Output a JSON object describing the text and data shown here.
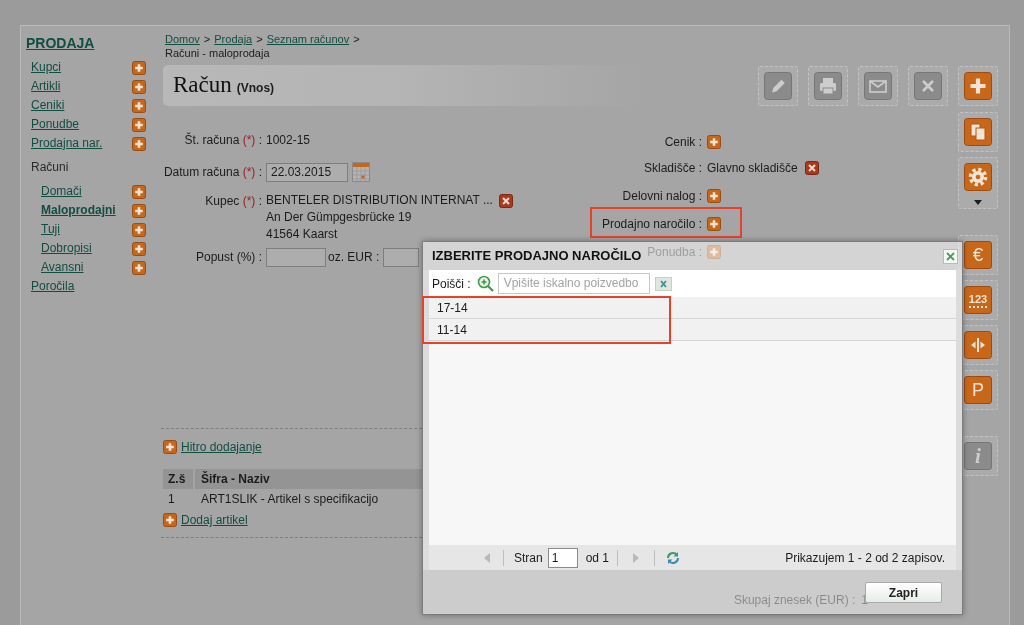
{
  "breadcrumb": [
    {
      "kind": "link",
      "label": "Domov",
      "separator": ">"
    },
    {
      "kind": "link",
      "label": "Prodaja",
      "separator": ">"
    },
    {
      "kind": "link",
      "label": "Seznam računov",
      "separator": ">"
    },
    {
      "kind": "current",
      "label": "Računi - maloprodaja"
    }
  ],
  "sidebar": {
    "title": "PRODAJA",
    "items": [
      {
        "kind": "link",
        "label": "Kupci",
        "selected": false,
        "add": true
      },
      {
        "kind": "link",
        "label": "Artikli",
        "selected": false,
        "add": true
      },
      {
        "kind": "link",
        "label": "Ceniki",
        "selected": false,
        "add": true
      },
      {
        "kind": "link",
        "label": "Ponudbe",
        "selected": false,
        "add": true
      },
      {
        "kind": "link",
        "label": "Prodajna nar.",
        "selected": false,
        "add": true
      },
      {
        "kind": "group",
        "label": "Računi",
        "selected": false,
        "add": false,
        "children": [
          {
            "kind": "link",
            "label": "Domači",
            "selected": false,
            "add": true
          },
          {
            "kind": "link",
            "label": "Maloprodajni",
            "selected": true,
            "add": true
          },
          {
            "kind": "link",
            "label": "Tuji",
            "selected": false,
            "add": true
          },
          {
            "kind": "link",
            "label": "Dobropisi",
            "selected": false,
            "add": true
          },
          {
            "kind": "link",
            "label": "Avansni",
            "selected": false,
            "add": true
          }
        ]
      },
      {
        "kind": "link",
        "label": "Poročila",
        "selected": false,
        "add": false
      }
    ]
  },
  "page_title": {
    "title": "Račun",
    "mode": "(Vnos)"
  },
  "toolbar": [
    {
      "kind": "edit",
      "disabled": true
    },
    {
      "kind": "print",
      "disabled": true
    },
    {
      "kind": "mail",
      "disabled": true
    },
    {
      "kind": "delete",
      "disabled": true
    },
    {
      "kind": "add",
      "disabled": false
    }
  ],
  "side_toolbar": [
    [
      {
        "kind": "copy",
        "disabled": false,
        "menu": false
      },
      {
        "kind": "settings",
        "disabled": false,
        "menu": true
      }
    ],
    [
      {
        "kind": "euro",
        "glyph": "€",
        "disabled": false,
        "menu": false
      },
      {
        "kind": "numbers",
        "glyph": "123",
        "disabled": false,
        "menu": false
      },
      {
        "kind": "split",
        "disabled": false,
        "menu": false
      },
      {
        "kind": "letter",
        "glyph": "P",
        "disabled": false,
        "menu": false
      }
    ],
    [
      {
        "kind": "info",
        "glyph": "i",
        "disabled": true,
        "menu": false
      }
    ]
  ],
  "form": {
    "left": [
      {
        "kind": "text",
        "label": "Št. računa",
        "required_mark": "(*)",
        "separator": ":",
        "value": "1002-15"
      },
      {
        "kind": "date",
        "label": "Datum računa",
        "required_mark": "(*)",
        "separator": ":",
        "value": "22.03.2015"
      },
      {
        "kind": "customer",
        "label": "Kupec",
        "required_mark": "(*)",
        "separator": ":",
        "lines": [
          "BENTELER DISTRIBUTION INTERNAT ...",
          "An Der Gümpgesbrücke 19",
          "41564 Kaarst"
        ]
      },
      {
        "kind": "discount",
        "label": "Popust (%)",
        "separator": ":",
        "second_label": "oz. EUR :"
      }
    ],
    "right": [
      {
        "kind": "add",
        "label": "Cenik :",
        "highlighted": false
      },
      {
        "kind": "value",
        "label": "Skladišče :",
        "value": "Glavno skladišče",
        "highlighted": false
      },
      {
        "kind": "add",
        "label": "Delovni nalog :",
        "highlighted": false
      },
      {
        "kind": "add",
        "label": "Prodajno naročilo :",
        "highlighted": true
      },
      {
        "kind": "add",
        "label": "Ponudba :",
        "highlighted": false
      }
    ]
  },
  "quick_add": "Hitro dodajanje",
  "items_table": {
    "columns": [
      "Z.š",
      "Šifra - Naziv"
    ],
    "rows": [
      [
        "1",
        "ART1SLIK - Artikel s specifikacijo"
      ]
    ]
  },
  "add_item": "Dodaj artikel",
  "totals": [
    {
      "label": "Skupaj znesek (EUR) :",
      "value": "1"
    }
  ],
  "dialog": {
    "title": "IZBERITE PRODAJNO NAROČILO",
    "search": {
      "label": "Poišči :",
      "placeholder": "Vpišite iskalno poizvedbo"
    },
    "rows": [
      {
        "label": "17-14",
        "selected": false
      },
      {
        "label": "11-14",
        "selected": false
      }
    ],
    "rows_highlighted": true,
    "pager": {
      "page_label": "Stran",
      "page": "1",
      "of_label": "od 1",
      "prev_enabled": false,
      "next_enabled": false,
      "summary": "Prikazujem 1 - 2 od 2 zapisov."
    },
    "close_label": "Zapri"
  }
}
